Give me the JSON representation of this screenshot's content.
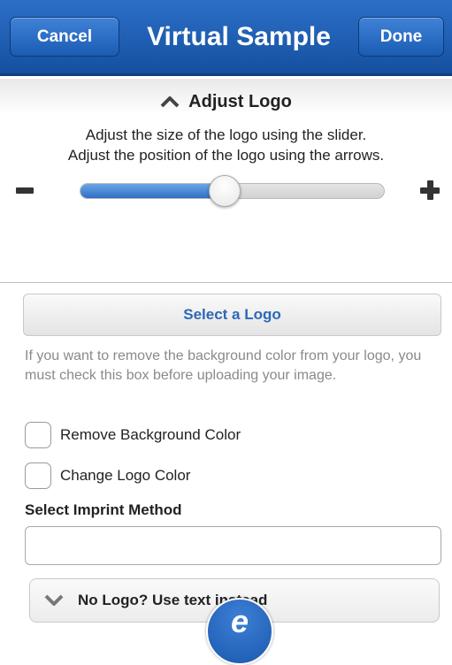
{
  "header": {
    "cancel_label": "Cancel",
    "title": "Virtual Sample",
    "done_label": "Done"
  },
  "adjust": {
    "heading": "Adjust Logo",
    "instructions_line1": "Adjust the size of the logo using the slider.",
    "instructions_line2": "Adjust the position of the logo using the arrows.",
    "slider_value_fraction": 0.5
  },
  "logo": {
    "select_label": "Select a Logo",
    "hint": "If you want to remove the background color from your logo, you must check this box before uploading your image."
  },
  "options": {
    "remove_bg_label": "Remove Background Color",
    "change_color_label": "Change Logo Color"
  },
  "imprint": {
    "label": "Select Imprint Method",
    "value": ""
  },
  "nologo": {
    "label": "No Logo? Use text instead"
  },
  "fab": {
    "glyph": "e"
  },
  "colors": {
    "header": "#1f60b6",
    "accent_link": "#2c68b8"
  }
}
